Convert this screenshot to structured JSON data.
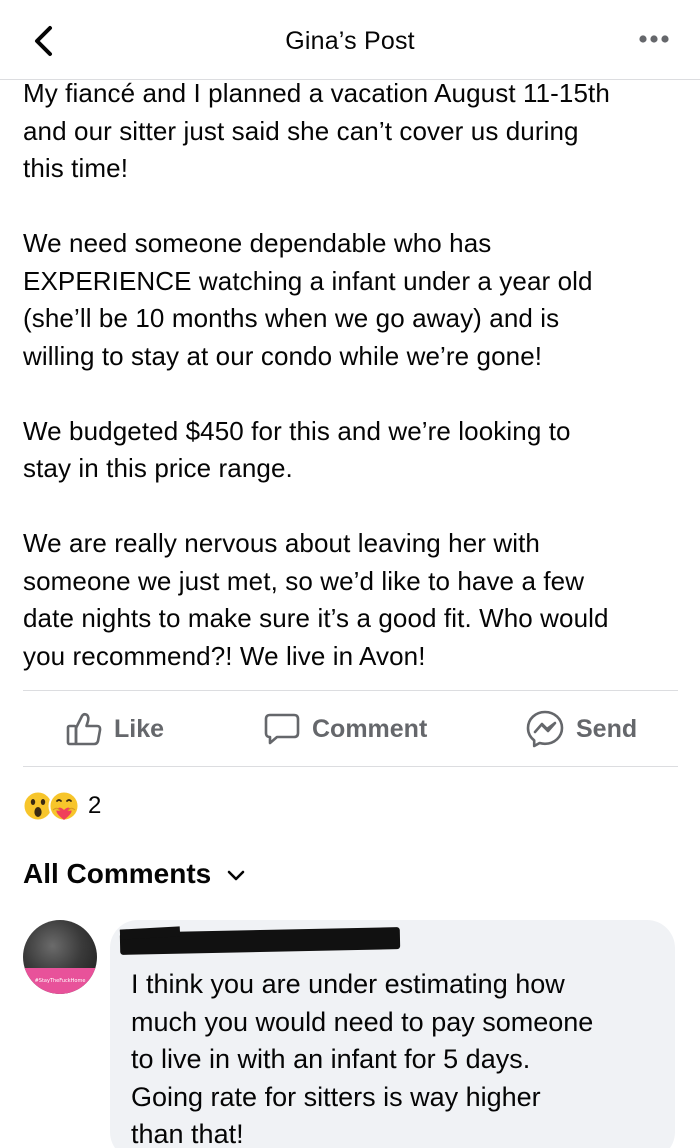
{
  "header": {
    "title": "Gina’s Post",
    "back_icon": "chevron-left-icon",
    "more_icon": "more-horizontal-icon"
  },
  "post": {
    "paragraphs": [
      "My fiancé and I planned a vacation August 11-15th\nand our sitter just said she can’t cover us during\nthis time!",
      "We need someone dependable who has\nEXPERIENCE watching a infant under a year old\n(she’ll be 10 months when we go away) and is\nwilling to stay at our condo while we’re gone!",
      "We budgeted $450 for this and we’re looking to\nstay in this price range.",
      "We are really nervous about leaving her with\nsomeone we just met, so we’d like to have a few\ndate nights to make sure it’s a good fit. Who would\nyou recommend?! We live in Avon!"
    ]
  },
  "actions": {
    "like_label": "Like",
    "comment_label": "Comment",
    "send_label": "Send",
    "like_icon": "thumbs-up-icon",
    "comment_icon": "speech-bubble-icon",
    "send_icon": "messenger-icon",
    "color": "#65676b"
  },
  "reactions": {
    "icons": [
      "wow-reaction-icon",
      "care-reaction-icon"
    ],
    "count": "2"
  },
  "comments": {
    "header_label": "All Comments",
    "header_icon": "chevron-down-icon",
    "items": [
      {
        "author_redacted": true,
        "avatar_badge_text": "#StayTheFuckHome",
        "text": "I think you are under estimating how\nmuch you would need to pay someone\nto live in with an infant for 5 days.\nGoing rate for sitters is way higher\nthan that!"
      }
    ]
  },
  "colors": {
    "text": "#050505",
    "muted": "#65676b",
    "divider": "#dcdde0",
    "bubble": "#f0f2f5",
    "avatar_band": "#e8529a"
  }
}
